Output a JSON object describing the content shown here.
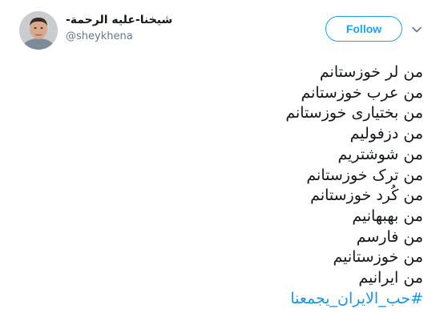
{
  "user": {
    "display_name": "شیخنا-علیه الرحمة-",
    "handle": "@sheykhena",
    "avatar": "avatar-photo"
  },
  "actions": {
    "follow_label": "Follow",
    "menu_icon": "chevron-down-icon"
  },
  "tweet": {
    "lines": [
      "من لر خوزستانم",
      "من عرب خوزستانم",
      "من بختیاری خوزستانم",
      "من دزفولیم",
      "من شوشتریم",
      "من ترک خوزستانم",
      "من کُرد خوزستانم",
      "من بهبهانیم",
      "من فارسم",
      "من خوزستانیم",
      "من ایرانیم"
    ],
    "hashtag": "#حب_الایران_یجمعنا"
  },
  "colors": {
    "accent": "#1da1f2",
    "hashtag": "#1b95e0",
    "text": "#14171a",
    "muted": "#657786"
  }
}
